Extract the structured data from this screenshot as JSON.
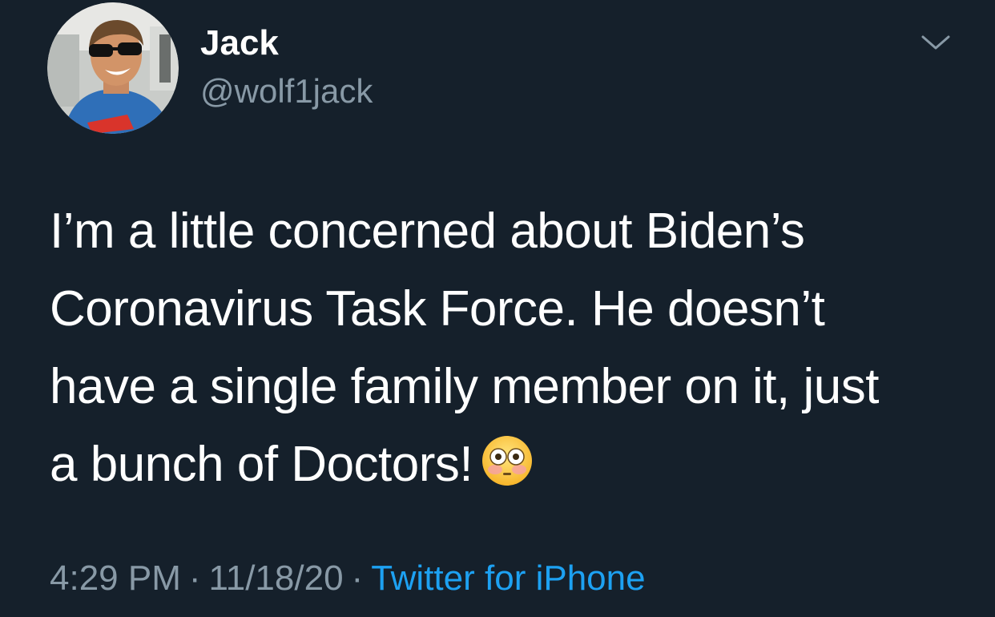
{
  "tweet": {
    "author": {
      "display_name": "Jack",
      "handle": "@wolf1jack"
    },
    "text_lines": [
      "I’m a little concerned about Biden’s",
      "Coronavirus Task Force. He doesn’t",
      "have a single family member on it, just",
      "a bunch of Doctors!"
    ],
    "emoji": "flushed-face",
    "time": "4:29 PM",
    "separator": "·",
    "date": "11/18/20",
    "source": "Twitter for iPhone"
  },
  "colors": {
    "background": "#15202b",
    "primary_text": "#ffffff",
    "secondary_text": "#8899a6",
    "link": "#1da1f2"
  },
  "icons": {
    "menu": "chevron-down-icon",
    "emoji": "flushed-face-icon"
  }
}
